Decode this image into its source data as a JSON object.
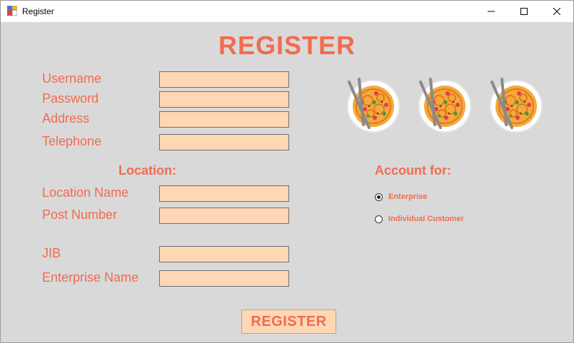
{
  "window": {
    "title": "Register"
  },
  "heading": "REGISTER",
  "fields": [
    {
      "label": "Username",
      "value": ""
    },
    {
      "label": "Password",
      "value": ""
    },
    {
      "label": "Address",
      "value": ""
    },
    {
      "label": "Telephone",
      "value": ""
    }
  ],
  "location": {
    "title": "Location:",
    "fields": [
      {
        "label": "Location Name",
        "value": ""
      },
      {
        "label": "Post Number",
        "value": ""
      }
    ]
  },
  "enterprise": {
    "fields": [
      {
        "label": "JIB",
        "value": ""
      },
      {
        "label": "Enterprise Name",
        "value": ""
      }
    ]
  },
  "account": {
    "title": "Account for:",
    "options": [
      {
        "label": "Enterprise",
        "checked": true
      },
      {
        "label": "Individual Customer",
        "checked": false
      }
    ]
  },
  "register_button": "REGISTER",
  "images": [
    "noodle-bowl-icon",
    "noodle-bowl-icon",
    "noodle-bowl-icon"
  ],
  "colors": {
    "accent": "#f26b50",
    "field_bg": "#ffd7b5",
    "background": "#d9d9d9"
  }
}
